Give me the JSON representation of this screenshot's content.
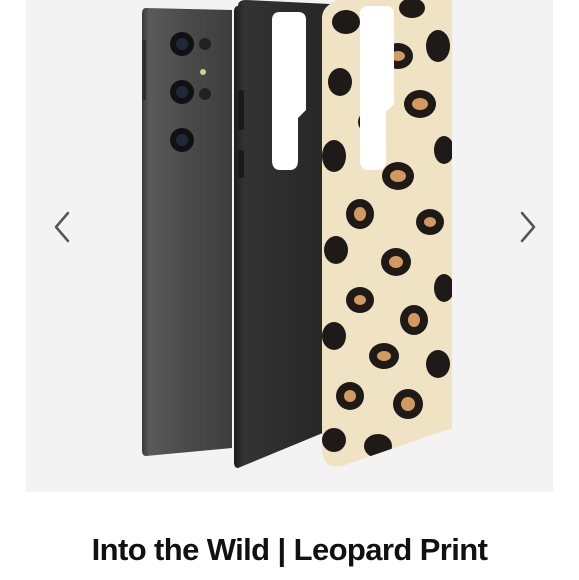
{
  "product": {
    "title": "Into the Wild | Leopard Print"
  },
  "gallery": {
    "prev_icon": "chevron-left-icon",
    "next_icon": "chevron-right-icon"
  },
  "colors": {
    "background": "#ffffff",
    "gallery_background": "#f3f3f3",
    "phone_body": "#4a4a4a",
    "inner_case": "#2b2b2b",
    "leopard_base": "#efe3c4",
    "leopard_spot": "#1e1a17",
    "leopard_center": "#d29a5e",
    "arrow": "#555555"
  }
}
